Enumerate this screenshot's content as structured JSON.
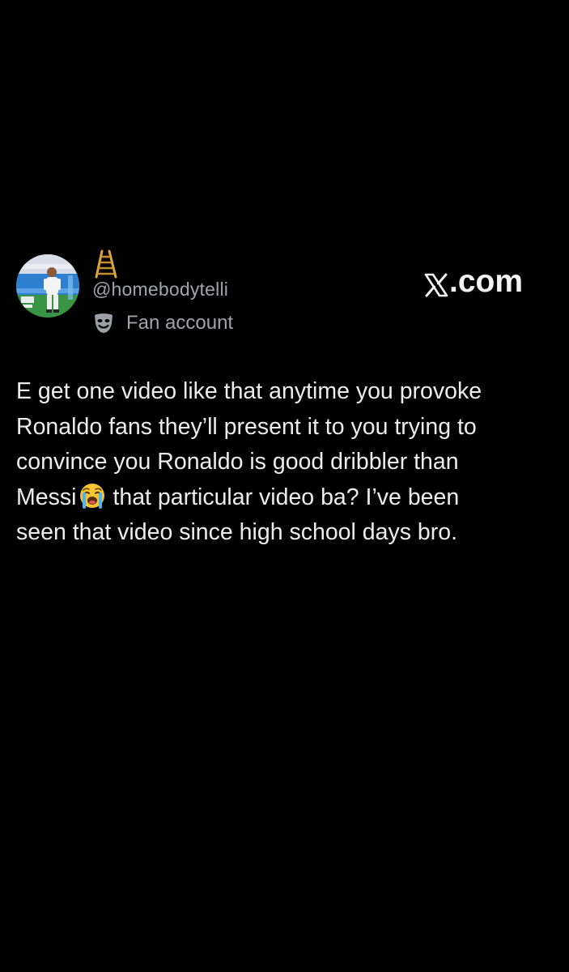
{
  "author": {
    "display_name_emoji": "ladder-emoji",
    "handle": "@homebodytelli",
    "label": "Fan account",
    "label_icon": "performing-arts-mask-icon",
    "avatar": "soccer-player-avatar"
  },
  "brand": {
    "text": ".com",
    "logo_icon": "x-logo-icon",
    "color": "#f2f2f2"
  },
  "tweet": {
    "line1": "E get one video like that anytime you provoke",
    "line2": "Ronaldo fans they’ll present it to you trying to",
    "line3": "convince you Ronaldo is good dribbler than",
    "line4_before_emoji": "Messi",
    "inline_emoji": "loudly-crying-face-emoji",
    "line4_after_emoji": "that particular video ba? I’ve been",
    "line5": "seen that video since high school days bro."
  },
  "colors": {
    "background": "#000000",
    "primary_text": "#ececec",
    "secondary_text": "#a0a4a8"
  }
}
